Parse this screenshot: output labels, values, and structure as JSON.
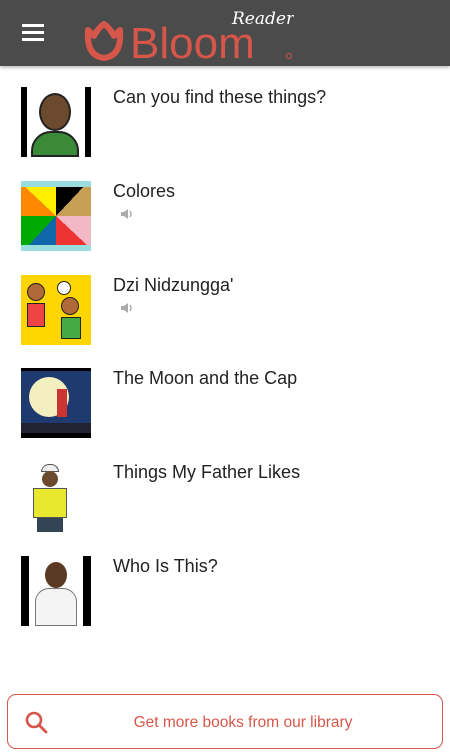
{
  "header": {
    "logo_text": "Bloom",
    "logo_subtext": "Reader",
    "menu_icon": "hamburger-icon",
    "brand_color": "#d65649",
    "bg_color": "#4b4b4b"
  },
  "books": [
    {
      "title": "Can you find these things?",
      "has_audio": false
    },
    {
      "title": "Colores",
      "has_audio": true
    },
    {
      "title": "Dzi Nidzungga'",
      "has_audio": true
    },
    {
      "title": "The Moon and the Cap",
      "has_audio": false
    },
    {
      "title": "Things My Father Likes",
      "has_audio": false
    },
    {
      "title": "Who Is This?",
      "has_audio": false
    }
  ],
  "library_button": {
    "label": "Get more books from our library",
    "icon": "search-icon"
  }
}
